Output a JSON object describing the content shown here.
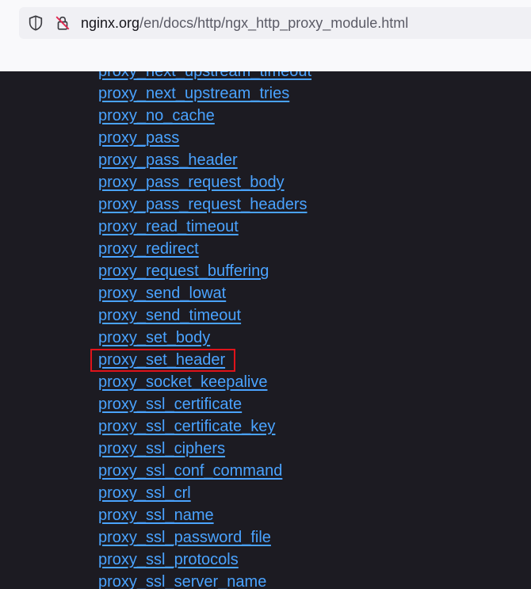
{
  "browser": {
    "url_domain": "nginx.org",
    "url_path": "/en/docs/http/ngx_http_proxy_module.html",
    "icons": [
      "shield-icon",
      "insecure-lock-icon"
    ]
  },
  "directives": [
    "proxy_next_upstream_timeout",
    "proxy_next_upstream_tries",
    "proxy_no_cache",
    "proxy_pass",
    "proxy_pass_header",
    "proxy_pass_request_body",
    "proxy_pass_request_headers",
    "proxy_read_timeout",
    "proxy_redirect",
    "proxy_request_buffering",
    "proxy_send_lowat",
    "proxy_send_timeout",
    "proxy_set_body",
    "proxy_set_header",
    "proxy_socket_keepalive",
    "proxy_ssl_certificate",
    "proxy_ssl_certificate_key",
    "proxy_ssl_ciphers",
    "proxy_ssl_conf_command",
    "proxy_ssl_crl",
    "proxy_ssl_name",
    "proxy_ssl_password_file",
    "proxy_ssl_protocols",
    "proxy_ssl_server_name"
  ],
  "highlighted": "proxy_set_header",
  "colors": {
    "link": "#4aa3ff",
    "background": "#1c1b22",
    "highlight": "#e0131a"
  }
}
